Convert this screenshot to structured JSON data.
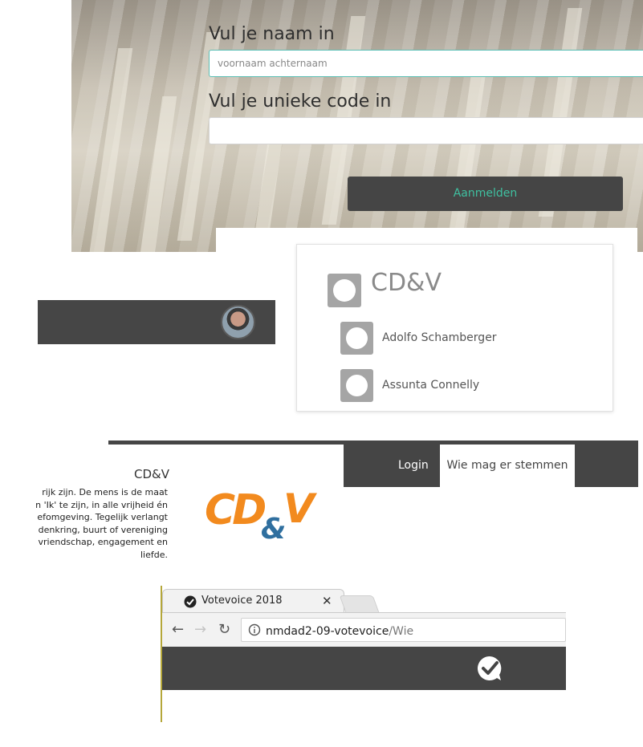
{
  "login": {
    "name_label": "Vul je naam in",
    "name_placeholder": "voornaam achternaam",
    "code_label": "Vul je unieke code in",
    "code_value": "",
    "submit_label": "Aanmelden"
  },
  "party_card": {
    "party_name": "CD&V",
    "candidates": [
      "Adolfo Schamberger",
      "Assunta Connelly"
    ]
  },
  "nav": {
    "login_label": "Login",
    "wie_label": "Wie mag er stemmen"
  },
  "about": {
    "title": "CD&V",
    "lines": [
      "rijk zijn. De mens is de maat",
      "n 'Ik' te zijn, in alle vrijheid én",
      "efomgeving. Tegelijk verlangt",
      "denkring, buurt of vereniging",
      "vriendschap, engagement en",
      "liefde."
    ]
  },
  "logo": {
    "text": "CD&V"
  },
  "browser": {
    "tab_title": "Votevoice 2018",
    "url_host": "nmdad2-09-votevoice",
    "url_path": "/Wie",
    "app_icon": "check-bubble-icon"
  },
  "colors": {
    "dark_bar": "#454545",
    "accent_teal": "#3fc0a0",
    "logo_orange": "#f28a1e",
    "logo_blue": "#2f6f9f"
  }
}
